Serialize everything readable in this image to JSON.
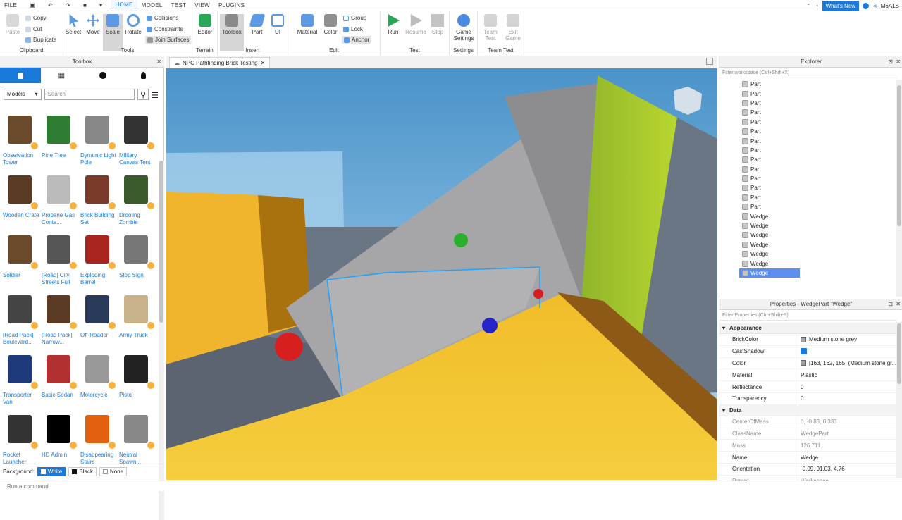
{
  "menu": {
    "file": "FILE",
    "tabs": [
      "HOME",
      "MODEL",
      "TEST",
      "VIEW",
      "PLUGINS"
    ],
    "active": "HOME"
  },
  "topright": {
    "whats_new": "What's New",
    "user": "M6ALS"
  },
  "ribbon": {
    "clipboard": {
      "paste": "Paste",
      "copy": "Copy",
      "cut": "Cut",
      "duplicate": "Duplicate",
      "label": "Clipboard"
    },
    "tools": {
      "select": "Select",
      "move": "Move",
      "scale": "Scale",
      "rotate": "Rotate",
      "collisions": "Collisions",
      "constraints": "Constraints",
      "join": "Join Surfaces",
      "label": "Tools"
    },
    "terrain": {
      "editor": "Editor",
      "label": "Terrain"
    },
    "insert": {
      "toolbox": "Toolbox",
      "part": "Part",
      "ui": "UI",
      "label": "Insert"
    },
    "edit": {
      "material": "Material",
      "color": "Color",
      "group": "Group",
      "lock": "Lock",
      "anchor": "Anchor",
      "label": "Edit"
    },
    "test": {
      "run": "Run",
      "resume": "Resume",
      "stop": "Stop",
      "label": "Test"
    },
    "settings": {
      "game": "Game\nSettings",
      "label": "Settings"
    },
    "teamtest": {
      "team": "Team\nTest",
      "exit": "Exit\nGame",
      "label": "Team Test"
    }
  },
  "toolbox": {
    "title": "Toolbox",
    "category": "Models",
    "search_placeholder": "Search",
    "items": [
      {
        "name": "Observation Tower"
      },
      {
        "name": "Pine Tree"
      },
      {
        "name": "Dynamic Light Pole"
      },
      {
        "name": "Military Canvas Tent"
      },
      {
        "name": "Wooden Crate"
      },
      {
        "name": "Propane Gas Conta..."
      },
      {
        "name": "Brick Building Set"
      },
      {
        "name": "Drooling Zombie"
      },
      {
        "name": "Soldier"
      },
      {
        "name": "[Road] City Streets Full"
      },
      {
        "name": "Exploding Barrel"
      },
      {
        "name": "Stop Sign"
      },
      {
        "name": "[Road Pack] Boulevard..."
      },
      {
        "name": "[Road Pack] Narrow..."
      },
      {
        "name": "Off-Roader"
      },
      {
        "name": "Army Truck"
      },
      {
        "name": "Transporter Van"
      },
      {
        "name": "Basic Sedan"
      },
      {
        "name": "Motorcycle"
      },
      {
        "name": "Pistol"
      },
      {
        "name": "Rocket Launcher"
      },
      {
        "name": "HD Admin"
      },
      {
        "name": "Disappearing Stairs"
      },
      {
        "name": "Neutral Spawn..."
      }
    ],
    "background_label": "Background:",
    "bg_options": [
      "White",
      "Black",
      "None"
    ]
  },
  "document_tab": "NPC Pathfinding Brick Testing",
  "explorer": {
    "title": "Explorer",
    "filter": "Filter workspace (Ctrl+Shift+X)",
    "rows": [
      "Part",
      "Part",
      "Part",
      "Part",
      "Part",
      "Part",
      "Part",
      "Part",
      "Part",
      "Part",
      "Part",
      "Part",
      "Part",
      "Part",
      "Wedge",
      "Wedge",
      "Wedge",
      "Wedge",
      "Wedge",
      "Wedge",
      "Wedge"
    ],
    "selected_index": 20
  },
  "properties": {
    "title": "Properties - WedgePart \"Wedge\"",
    "filter": "Filter Properties (Ctrl+Shift+P)",
    "appearance_label": "Appearance",
    "appearance": [
      {
        "k": "BrickColor",
        "v": "Medium stone grey"
      },
      {
        "k": "CastShadow",
        "v": ""
      },
      {
        "k": "Color",
        "v": "[163, 162, 165] (Medium stone gr..."
      },
      {
        "k": "Material",
        "v": "Plastic"
      },
      {
        "k": "Reflectance",
        "v": "0"
      },
      {
        "k": "Transparency",
        "v": "0"
      }
    ],
    "data_label": "Data",
    "data": [
      {
        "k": "CenterOfMass",
        "v": "0, -0.83, 0.333"
      },
      {
        "k": "ClassName",
        "v": "WedgePart"
      },
      {
        "k": "Mass",
        "v": "126.711"
      },
      {
        "k": "Name",
        "v": "Wedge"
      },
      {
        "k": "Orientation",
        "v": "-0.09, 91.03, 4.76"
      },
      {
        "k": "Parent",
        "v": "Workspace"
      }
    ]
  },
  "command_placeholder": "Run a command",
  "colors": {
    "accent": "#1a7ad9",
    "selection": "#5b8ff0",
    "sand": "#f2c12e",
    "grass": "#b8d62a",
    "grey": "#a3a2a5"
  }
}
